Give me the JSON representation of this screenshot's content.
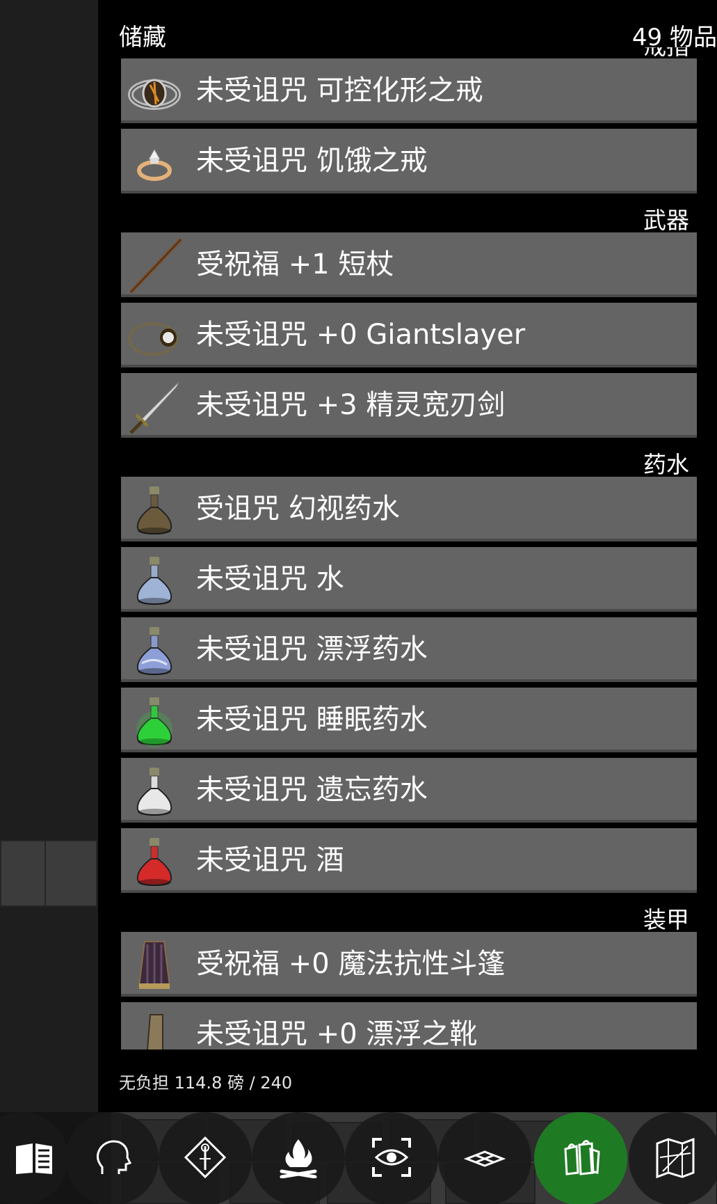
{
  "panel": {
    "title": "储藏",
    "item_count": "49 物品"
  },
  "categories": [
    {
      "name": "戒指",
      "items": [
        {
          "label": "未受诅咒 可控化形之戒",
          "icon": "eye-ring-icon"
        },
        {
          "label": "未受诅咒 饥饿之戒",
          "icon": "gem-ring-icon"
        }
      ]
    },
    {
      "name": "武器",
      "items": [
        {
          "label": "受祝福 +1 短杖",
          "icon": "staff-icon"
        },
        {
          "label": "未受诅咒 +0 Giantslayer",
          "icon": "sling-icon"
        },
        {
          "label": "未受诅咒 +3 精灵宽刃剑",
          "icon": "sword-icon"
        }
      ]
    },
    {
      "name": "药水",
      "items": [
        {
          "label": "受诅咒 幻视药水",
          "icon": "brown-potion-icon",
          "color": "#6b5a3c"
        },
        {
          "label": "未受诅咒 水",
          "icon": "water-potion-icon",
          "color": "#9fb3d6"
        },
        {
          "label": "未受诅咒 漂浮药水",
          "icon": "swirl-potion-icon",
          "color": "#8e9fd8"
        },
        {
          "label": "未受诅咒 睡眠药水",
          "icon": "green-potion-icon",
          "color": "#2ed13a"
        },
        {
          "label": "未受诅咒 遗忘药水",
          "icon": "white-potion-icon",
          "color": "#e8e8e8"
        },
        {
          "label": "未受诅咒 酒",
          "icon": "red-potion-icon",
          "color": "#d42a2a"
        }
      ]
    },
    {
      "name": "装甲",
      "items": [
        {
          "label": "受祝福 +0 魔法抗性斗篷",
          "icon": "cloak-icon"
        },
        {
          "label": "未受诅咒 +0 漂浮之靴",
          "icon": "boots-icon"
        }
      ]
    }
  ],
  "footer": {
    "burden": "无负担 114.8 磅 / 240"
  },
  "toolbar": [
    {
      "name": "spellbook-icon",
      "active": false
    },
    {
      "name": "character-head-icon",
      "active": false
    },
    {
      "name": "skills-diamond-icon",
      "active": false
    },
    {
      "name": "campfire-icon",
      "active": false
    },
    {
      "name": "look-eye-icon",
      "active": false
    },
    {
      "name": "floor-tiles-icon",
      "active": false
    },
    {
      "name": "inventory-bags-icon",
      "active": true
    },
    {
      "name": "map-icon",
      "active": false
    }
  ],
  "colors": {
    "row_bg": "#646464",
    "panel_bg": "#000000",
    "active_button": "#1f7a24"
  }
}
